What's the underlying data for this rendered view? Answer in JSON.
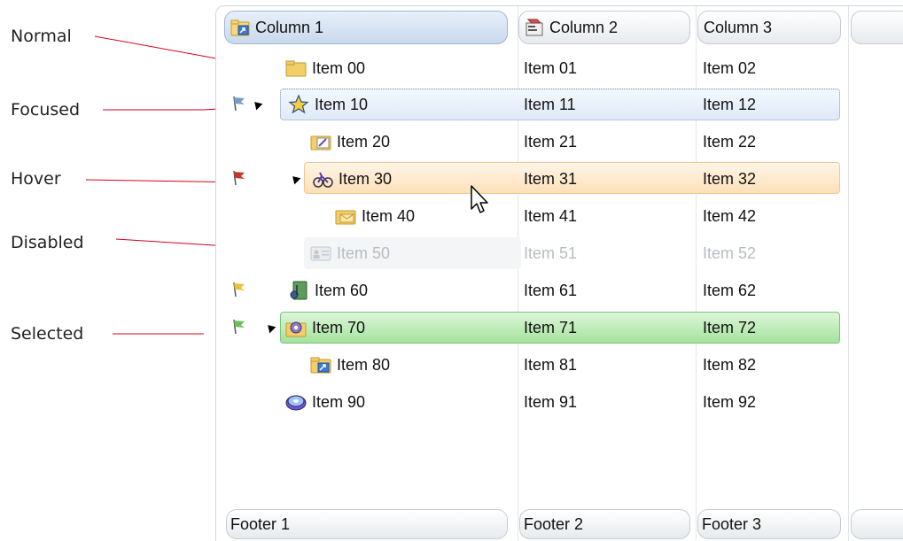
{
  "annotations": {
    "normal": "Normal",
    "focused": "Focused",
    "hover": "Hover",
    "disabled": "Disabled",
    "selected": "Selected"
  },
  "columns": {
    "col1": "Column 1",
    "col2": "Column 2",
    "col3": "Column 3"
  },
  "footers": {
    "f1": "Footer 1",
    "f2": "Footer 2",
    "f3": "Footer 3"
  },
  "rows": [
    {
      "c1": "Item 00",
      "c2": "Item 01",
      "c3": "Item 02",
      "icon": "folder-icon",
      "state": "normal"
    },
    {
      "c1": "Item 10",
      "c2": "Item 11",
      "c3": "Item 12",
      "icon": "star-icon",
      "state": "focused",
      "flag": "blue-flag-icon",
      "expanded": true
    },
    {
      "c1": "Item 20",
      "c2": "Item 21",
      "c3": "Item 22",
      "icon": "edit-folder-icon",
      "state": "normal"
    },
    {
      "c1": "Item 30",
      "c2": "Item 31",
      "c3": "Item 32",
      "icon": "bicycle-icon",
      "state": "hover",
      "flag": "red-flag-icon",
      "expanded": true
    },
    {
      "c1": "Item 40",
      "c2": "Item 41",
      "c3": "Item 42",
      "icon": "mail-folder-icon",
      "state": "normal"
    },
    {
      "c1": "Item 50",
      "c2": "Item 51",
      "c3": "Item 52",
      "icon": "contact-card-icon",
      "state": "disabled"
    },
    {
      "c1": "Item 60",
      "c2": "Item 61",
      "c3": "Item 62",
      "icon": "media-icon",
      "state": "normal",
      "flag": "yellow-flag-icon"
    },
    {
      "c1": "Item 70",
      "c2": "Item 71",
      "c3": "Item 72",
      "icon": "settings-folder-icon",
      "state": "selected",
      "flag": "green-flag-icon",
      "expanded": true
    },
    {
      "c1": "Item 80",
      "c2": "Item 81",
      "c3": "Item 82",
      "icon": "shortcut-folder-icon",
      "state": "normal"
    },
    {
      "c1": "Item 90",
      "c2": "Item 91",
      "c3": "Item 92",
      "icon": "disc-icon",
      "state": "normal"
    }
  ],
  "colors": {
    "focused": "#dfeaf8",
    "hover": "#fde0b8",
    "selected": "#a5e39d",
    "annotation_line": "#d0021b"
  }
}
